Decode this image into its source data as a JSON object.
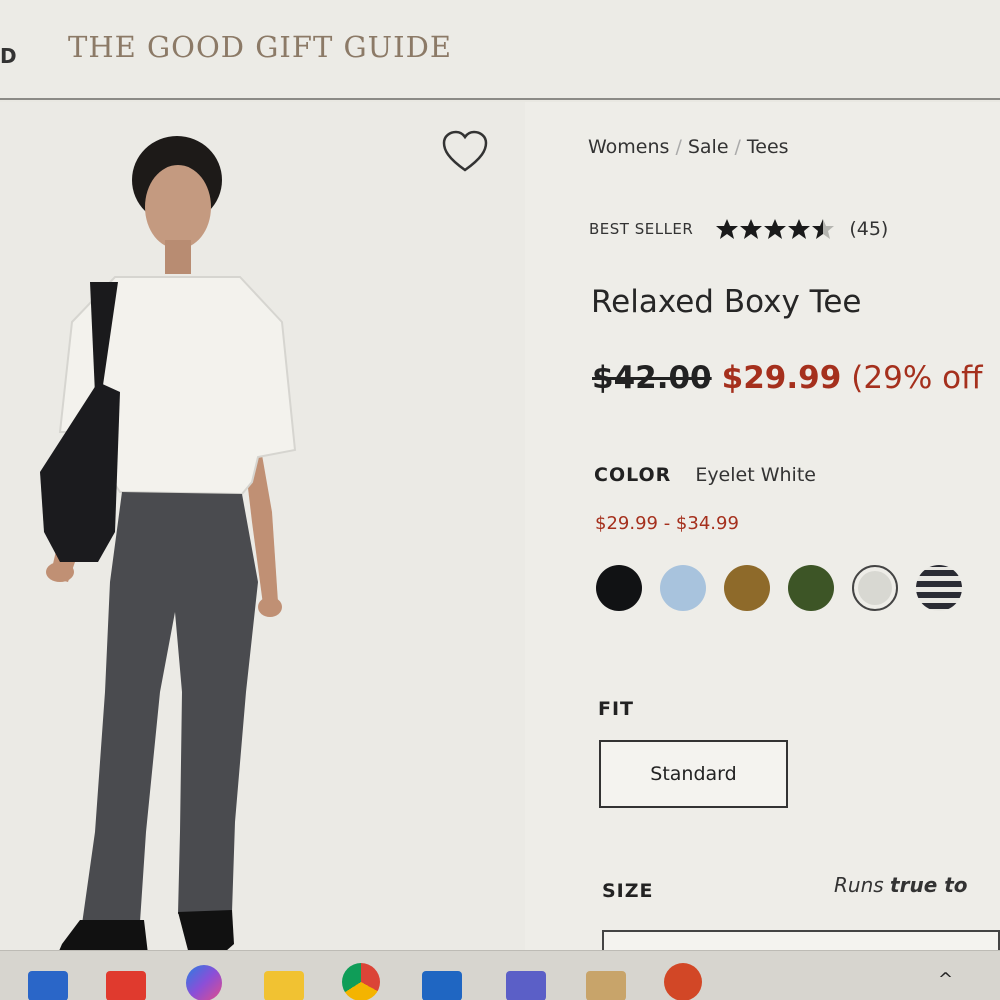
{
  "header": {
    "nav_stub": "D",
    "gift_guide": "THE GOOD GIFT GUIDE"
  },
  "breadcrumb": [
    "Womens",
    "Sale",
    "Tees"
  ],
  "product": {
    "badge": "BEST SELLER",
    "rating": 4.5,
    "rating_max": 5,
    "review_count": "(45)",
    "title": "Relaxed Boxy Tee",
    "original_price": "$42.00",
    "sale_price": "$29.99",
    "discount": "(29% off",
    "color_label": "COLOR",
    "color_name": "Eyelet White",
    "price_range": "$29.99 - $34.99",
    "swatches": [
      {
        "name": "black",
        "color": "#111214"
      },
      {
        "name": "light-blue",
        "color": "#a8c3dd"
      },
      {
        "name": "mustard",
        "color": "#8e6a2a"
      },
      {
        "name": "olive-green",
        "color": "#3d5526"
      },
      {
        "name": "eyelet-white",
        "color": "#d8d8d2",
        "selected": true
      },
      {
        "name": "navy-stripe",
        "color": "#2a2b33"
      }
    ],
    "fit_label": "FIT",
    "fit_option": "Standard",
    "size_label": "SIZE",
    "size_note_prefix": "Runs ",
    "size_note_bold": "true to",
    "size_note_suffix": " "
  },
  "colors": {
    "sale_red": "#a5301d",
    "gift_guide_brown": "#8c7a67"
  },
  "taskbar": {
    "icons": [
      "widgets-icon",
      "media-icon",
      "copilot-icon",
      "file-explorer-icon",
      "chrome-icon",
      "outlook-icon",
      "teams-icon",
      "snipping-tool-icon",
      "powerpoint-icon"
    ],
    "tray_chevron": "^"
  }
}
